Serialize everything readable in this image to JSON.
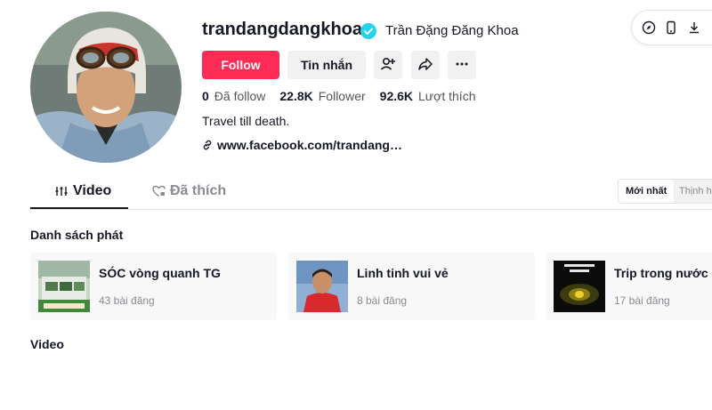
{
  "profile": {
    "username": "trandangdangkhoa",
    "nickname": "Trần Đặng Đăng Khoa",
    "verified": true,
    "bio": "Travel till death.",
    "link": "www.facebook.com/trandang…"
  },
  "actions": {
    "follow_label": "Follow",
    "message_label": "Tin nhắn",
    "icons": [
      "add-friend-icon",
      "share-icon",
      "more-icon"
    ]
  },
  "top_actions": {
    "icons": [
      "compass-icon",
      "phone-icon",
      "download-icon"
    ]
  },
  "stats": [
    {
      "number": "0",
      "label": "Đã follow"
    },
    {
      "number": "22.8K",
      "label": "Follower"
    },
    {
      "number": "92.6K",
      "label": "Lượt thích"
    }
  ],
  "tabs": [
    {
      "label": "Video",
      "active": true
    },
    {
      "label": "Đã thích",
      "active": false
    }
  ],
  "sort": {
    "options": [
      "Mới nhất",
      "Thịnh hành"
    ],
    "selected": "Mới nhất"
  },
  "playlists": {
    "title": "Danh sách phát",
    "items": [
      {
        "name": "SÓC vòng quanh TG",
        "count": "43 bài đăng"
      },
      {
        "name": "Linh tinh vui vẻ",
        "count": "8 bài đăng"
      },
      {
        "name": "Trip trong nước",
        "count": "17 bài đăng"
      }
    ]
  },
  "videos": {
    "title": "Video"
  },
  "colors": {
    "accent": "#fe2c55",
    "verified": "#20d5ec",
    "button_bg": "#f1f1f2",
    "text": "#161823",
    "muted": "#8a8b91"
  }
}
